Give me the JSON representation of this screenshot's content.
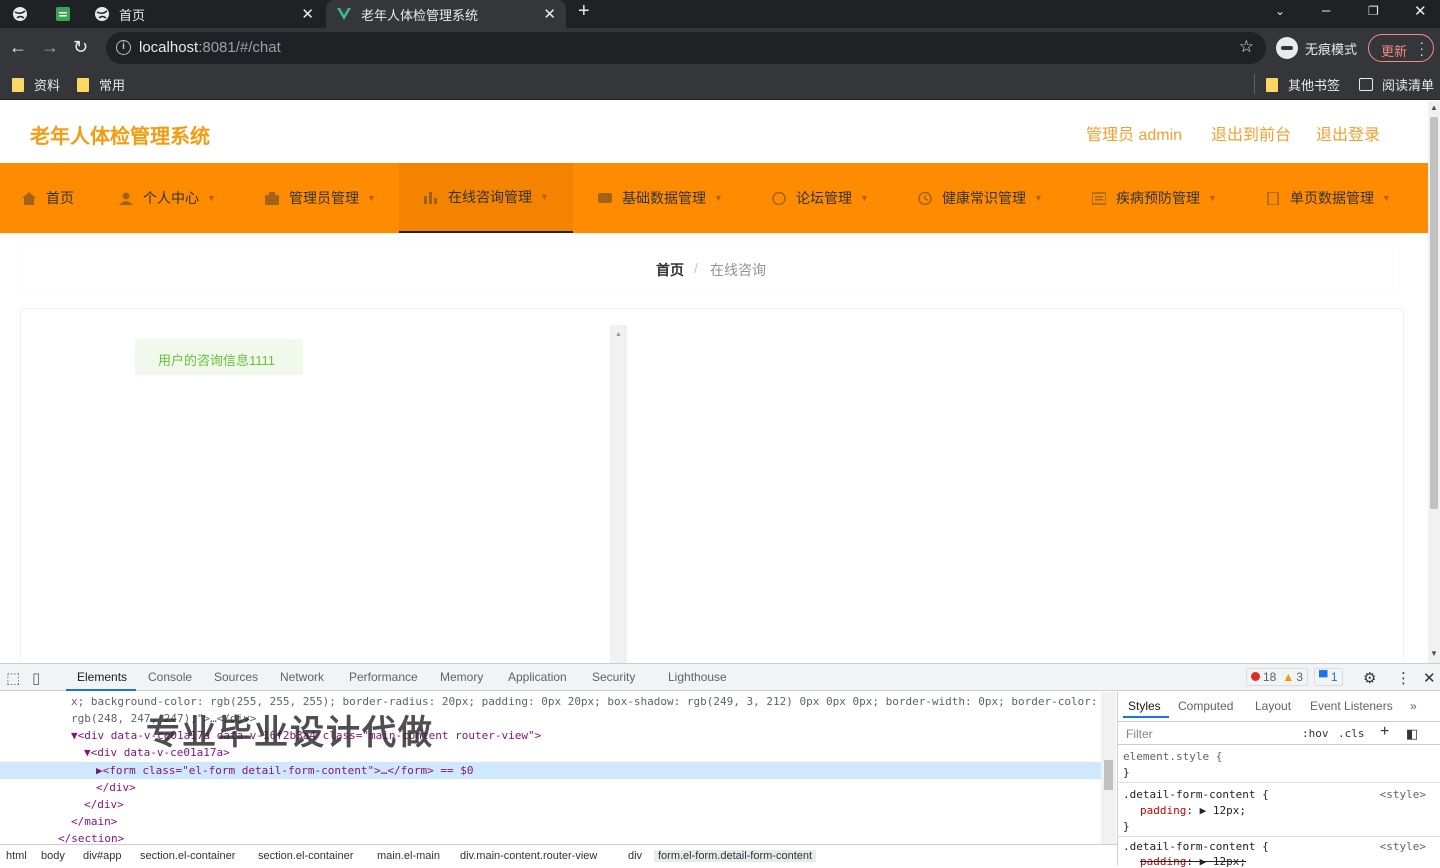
{
  "browser": {
    "tabs": [
      {
        "title": "首页"
      },
      {
        "title": "老年人体检管理系统"
      }
    ],
    "url_host": "localhost",
    "url_rest": ":8081/#/chat",
    "incognito_label": "无痕模式",
    "update_label": "更新",
    "bookmarks": [
      "资料",
      "常用"
    ],
    "bookmarks_right": [
      "其他书签",
      "阅读清单"
    ]
  },
  "site": {
    "title": "老年人体检管理系统",
    "header_links": [
      "管理员 admin",
      "退出到前台",
      "退出登录"
    ],
    "menu": [
      {
        "label": "首页",
        "icon": "home-icon",
        "has_caret": false
      },
      {
        "label": "个人中心",
        "icon": "user-icon",
        "has_caret": true
      },
      {
        "label": "管理员管理",
        "icon": "admin-icon",
        "has_caret": true
      },
      {
        "label": "在线咨询管理",
        "icon": "chart-icon",
        "has_caret": true,
        "active": true
      },
      {
        "label": "基础数据管理",
        "icon": "data-icon",
        "has_caret": true
      },
      {
        "label": "论坛管理",
        "icon": "forum-icon",
        "has_caret": true
      },
      {
        "label": "健康常识管理",
        "icon": "health-icon",
        "has_caret": true
      },
      {
        "label": "疾病预防管理",
        "icon": "disease-icon",
        "has_caret": true
      },
      {
        "label": "单页数据管理",
        "icon": "page-icon",
        "has_caret": true
      }
    ],
    "breadcrumb": {
      "home": "首页",
      "separator": "/",
      "current": "在线咨询"
    },
    "chat": {
      "message": "用户的咨询信息1111"
    },
    "colors": {
      "accent": "#ff8c00",
      "title": "#f39c12",
      "bubble_bg": "#f0f9eb",
      "bubble_text": "#67c23a"
    }
  },
  "devtools": {
    "tabs": [
      "Elements",
      "Console",
      "Sources",
      "Network",
      "Performance",
      "Memory",
      "Application",
      "Security",
      "Lighthouse"
    ],
    "errors": "18",
    "warnings": "3",
    "messages": "1",
    "code_lines": [
      "x; background-color: rgb(255, 255, 255); border-radius: 20px; padding: 0px 20px; box-shadow: rgb(249, 3, 212) 0px 0px 0px; border-width: 0px; border-color:",
      "rgb(248, 247, 247);\">…</div>",
      "▼<div data-v-ce01a17a data-v-16f2b3a4 class=\"main-content router-view\">",
      "▼<div data-v-ce01a17a>",
      "▶<form class=\"el-form detail-form-content\">…</form> == $0",
      "</div>",
      "</div>",
      "</main>",
      "</section>"
    ],
    "watermark": "专业毕业设计代做",
    "styles_tabs": [
      "Styles",
      "Computed",
      "Layout",
      "Event Listeners"
    ],
    "filter_placeholder": "Filter",
    "hov": ":hov",
    "cls": ".cls",
    "css_rules": [
      {
        "selector": "element.style {",
        "close": "}"
      },
      {
        "selector": ".detail-form-content {",
        "prop": "padding",
        "value": "12px;",
        "source": "<style>",
        "close": "}"
      },
      {
        "selector": ".detail-form-content {",
        "prop": "padding",
        "value": "12px;",
        "source": "<style>"
      }
    ],
    "dom_breadcrumbs": [
      "html",
      "body",
      "div#app",
      "section.el-container",
      "section.el-container",
      "main.el-main",
      "div.main-content.router-view",
      "div",
      "form.el-form.detail-form-content"
    ]
  }
}
